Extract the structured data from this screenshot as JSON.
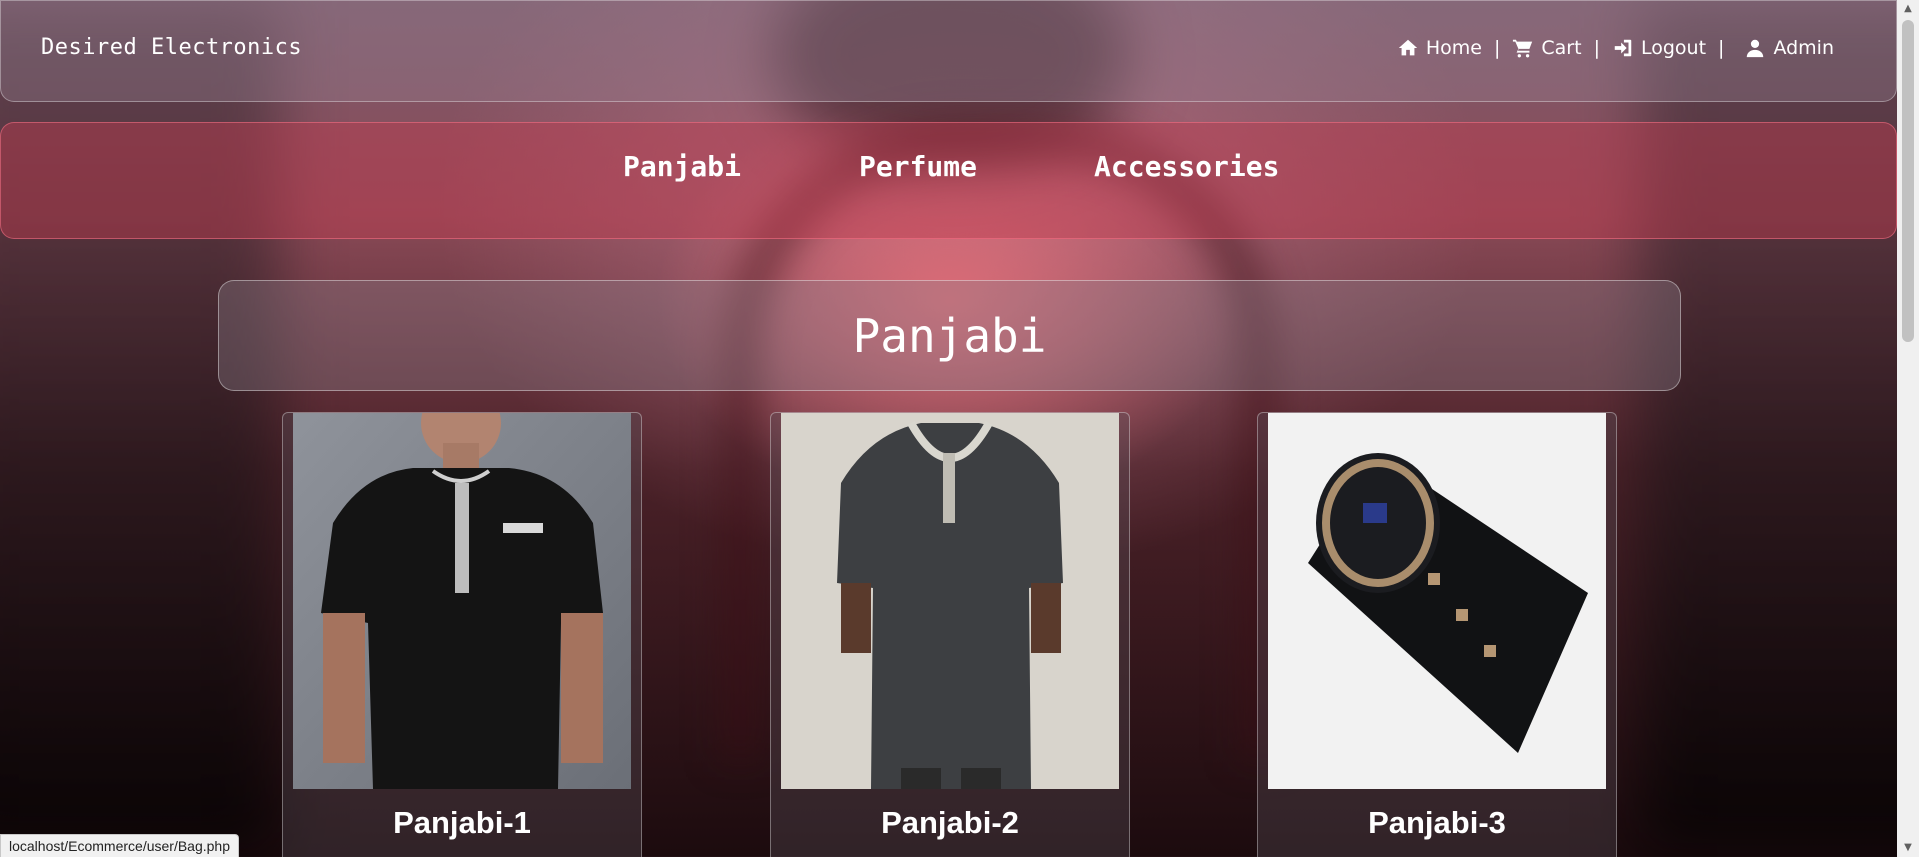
{
  "header": {
    "brand": "Desired Electronics",
    "links": [
      {
        "label": "Home",
        "icon": "home-icon"
      },
      {
        "label": "Cart",
        "icon": "cart-icon"
      },
      {
        "label": "Logout",
        "icon": "logout-icon"
      },
      {
        "label": "Admin",
        "icon": "user-icon"
      }
    ],
    "separator": "|"
  },
  "categories": [
    "Panjabi",
    "Perfume",
    "Accessories"
  ],
  "section": {
    "title": "Panjabi"
  },
  "products": [
    {
      "name": "Panjabi-1",
      "image": "man wearing black embroidered panjabi"
    },
    {
      "name": "Panjabi-2",
      "image": "man wearing grey long panjabi"
    },
    {
      "name": "Panjabi-3",
      "image": "folded black panjabi with gold buttons"
    }
  ],
  "status_url": "localhost/Ecommerce/user/Bag.php",
  "colors": {
    "header_bg": "#968291",
    "category_bar": "#be3c50",
    "text": "#ffffff"
  }
}
